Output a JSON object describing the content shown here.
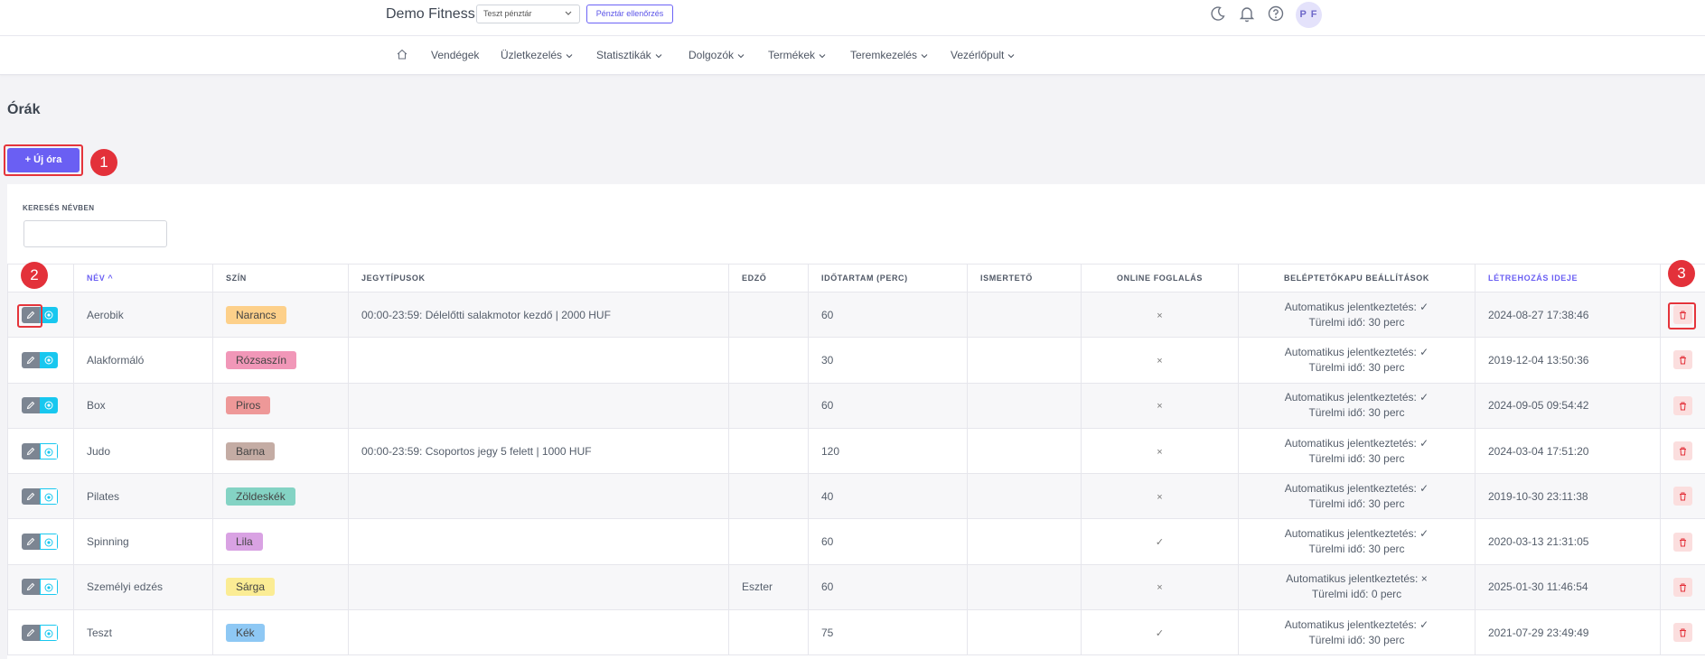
{
  "header": {
    "brand": "Demo Fitness",
    "register_select": "Teszt pénztár",
    "register_check_button": "Pénztár ellenőrzés",
    "avatar_initials": "P F"
  },
  "nav": {
    "items": [
      {
        "label": "Vendégek",
        "dropdown": false
      },
      {
        "label": "Üzletkezelés",
        "dropdown": true
      },
      {
        "label": "Statisztikák",
        "dropdown": true
      },
      {
        "label": "Dolgozók",
        "dropdown": true
      },
      {
        "label": "Termékek",
        "dropdown": true
      },
      {
        "label": "Teremkezelés",
        "dropdown": true
      },
      {
        "label": "Vezérlőpult",
        "dropdown": true
      }
    ]
  },
  "page": {
    "title": "Órák",
    "new_button": "Új óra",
    "new_button_icon": "+"
  },
  "markers": [
    "1",
    "2",
    "3"
  ],
  "search": {
    "label": "KERESÉS NÉVBEN",
    "value": "",
    "placeholder": ""
  },
  "table": {
    "headers": {
      "name": "NÉV",
      "name_sort_icon": "^",
      "color": "SZÍN",
      "tickets": "JEGYTÍPUSOK",
      "trainer": "EDZŐ",
      "duration": "IDŐTARTAM (PERC)",
      "description": "ISMERTETŐ",
      "online": "ONLINE FOGLALÁS",
      "gate": "BELÉPTETŐKAPU BEÁLLÍTÁSOK",
      "created": "LÉTREHOZÁS IDEJE"
    },
    "rows": [
      {
        "name": "Aerobik",
        "color": "Narancs",
        "color_hex": "#fdd08a",
        "tickets": "00:00-23:59: Délelőtti salakmotor kezdő | 2000 HUF",
        "trainer": "",
        "duration": "60",
        "description": "",
        "online": "×",
        "gate_line1": "Automatikus jelentkeztetés: ✓",
        "gate_line2": "Türelmi idő: 30 perc",
        "created": "2024-08-27 17:38:46",
        "view_style": "filled"
      },
      {
        "name": "Alakformáló",
        "color": "Rózsaszín",
        "color_hex": "#f197b8",
        "tickets": "",
        "trainer": "",
        "duration": "30",
        "description": "",
        "online": "×",
        "gate_line1": "Automatikus jelentkeztetés: ✓",
        "gate_line2": "Türelmi idő: 30 perc",
        "created": "2019-12-04 13:50:36",
        "view_style": "filled"
      },
      {
        "name": "Box",
        "color": "Piros",
        "color_hex": "#ee9898",
        "tickets": "",
        "trainer": "",
        "duration": "60",
        "description": "",
        "online": "×",
        "gate_line1": "Automatikus jelentkeztetés: ✓",
        "gate_line2": "Türelmi idő: 30 perc",
        "created": "2024-09-05 09:54:42",
        "view_style": "filled"
      },
      {
        "name": "Judo",
        "color": "Barna",
        "color_hex": "#c4aca4",
        "tickets": "00:00-23:59: Csoportos jegy 5 felett | 1000 HUF",
        "trainer": "",
        "duration": "120",
        "description": "",
        "online": "×",
        "gate_line1": "Automatikus jelentkeztetés: ✓",
        "gate_line2": "Türelmi idő: 30 perc",
        "created": "2024-03-04 17:51:20",
        "view_style": "outline"
      },
      {
        "name": "Pilates",
        "color": "Zöldeskék",
        "color_hex": "#84d3c4",
        "tickets": "",
        "trainer": "",
        "duration": "40",
        "description": "",
        "online": "×",
        "gate_line1": "Automatikus jelentkeztetés: ✓",
        "gate_line2": "Türelmi idő: 30 perc",
        "created": "2019-10-30 23:11:38",
        "view_style": "outline"
      },
      {
        "name": "Spinning",
        "color": "Lila",
        "color_hex": "#d9a2e3",
        "tickets": "",
        "trainer": "",
        "duration": "60",
        "description": "",
        "online": "✓",
        "gate_line1": "Automatikus jelentkeztetés: ✓",
        "gate_line2": "Türelmi idő: 30 perc",
        "created": "2020-03-13 21:31:05",
        "view_style": "outline"
      },
      {
        "name": "Személyi edzés",
        "color": "Sárga",
        "color_hex": "#fbec94",
        "tickets": "",
        "trainer": "Eszter",
        "duration": "60",
        "description": "",
        "online": "×",
        "gate_line1": "Automatikus jelentkeztetés: ×",
        "gate_line2": "Türelmi idő: 0 perc",
        "created": "2025-01-30 11:46:54",
        "view_style": "outline"
      },
      {
        "name": "Teszt",
        "color": "Kék",
        "color_hex": "#8ec8f4",
        "tickets": "",
        "trainer": "",
        "duration": "75",
        "description": "",
        "online": "✓",
        "gate_line1": "Automatikus jelentkeztetés: ✓",
        "gate_line2": "Türelmi idő: 30 perc",
        "created": "2021-07-29 23:49:49",
        "view_style": "outline"
      }
    ]
  },
  "icons": {
    "home": "home-icon",
    "moon": "moon-icon",
    "bell": "bell-icon",
    "help": "help-icon",
    "edit": "pencil-icon",
    "view": "eye-icon",
    "delete": "trash-icon"
  },
  "colors": {
    "accent": "#6a5ff3",
    "info": "#18c7ef",
    "danger": "#e3313a",
    "danger_soft": "#fbdede"
  }
}
